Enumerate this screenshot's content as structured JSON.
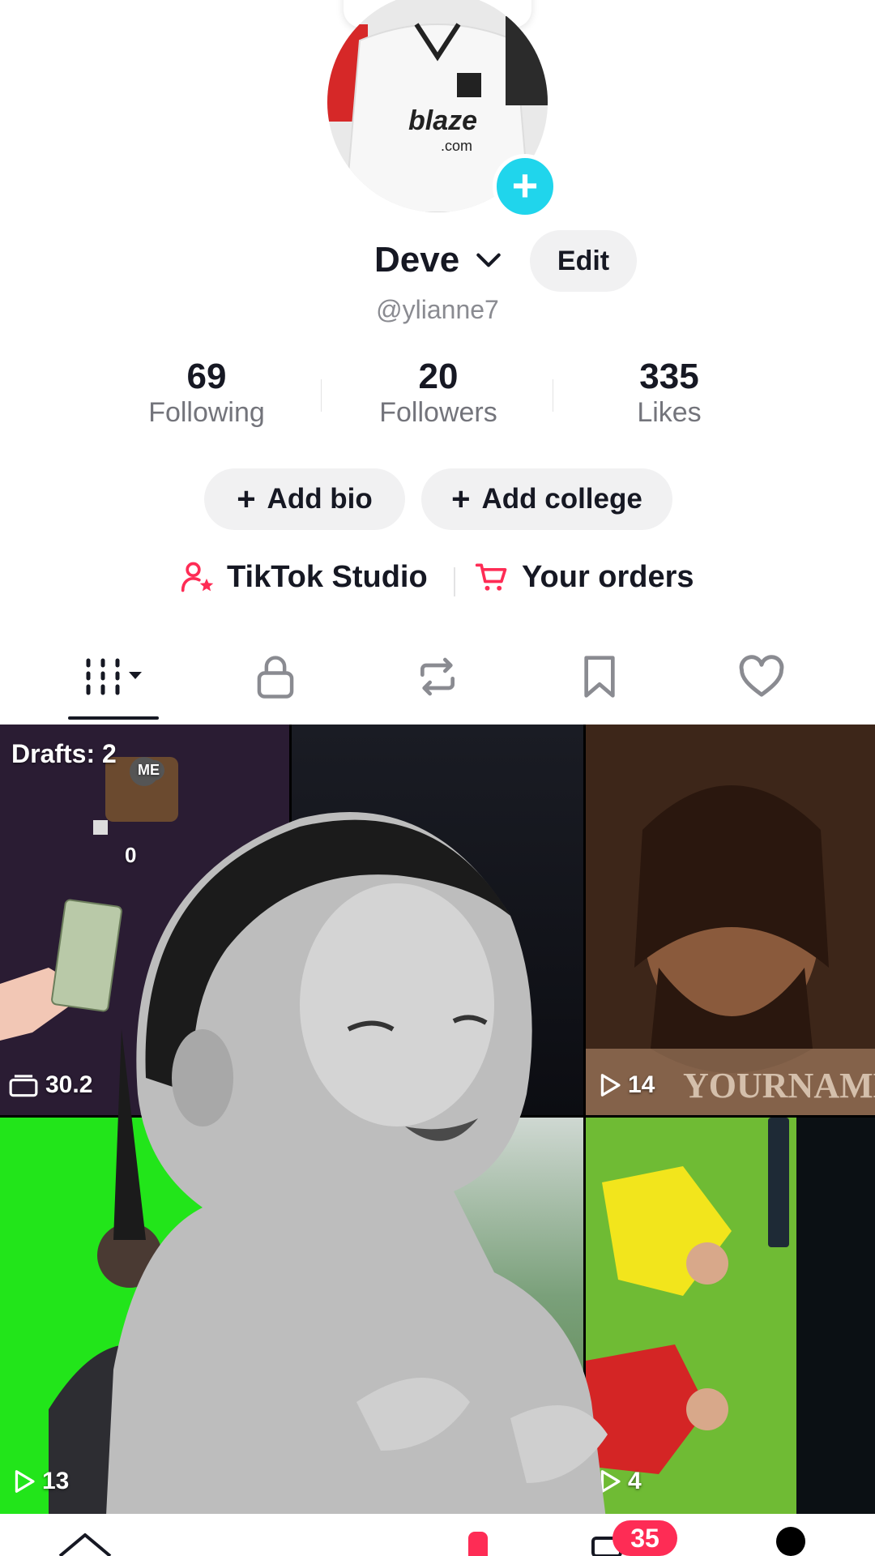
{
  "profile": {
    "display_name": "Deve",
    "username": "@ylianne7",
    "edit_label": "Edit"
  },
  "stats": [
    {
      "value": "69",
      "label": "Following"
    },
    {
      "value": "20",
      "label": "Followers"
    },
    {
      "value": "335",
      "label": "Likes"
    }
  ],
  "actions": {
    "add_bio": "Add bio",
    "add_college": "Add college",
    "plus": "+"
  },
  "links": {
    "studio": "TikTok Studio",
    "orders": "Your orders"
  },
  "tabs": [
    {
      "name": "videos",
      "icon": "grid-icon"
    },
    {
      "name": "private",
      "icon": "lock-icon"
    },
    {
      "name": "reposts",
      "icon": "repost-icon"
    },
    {
      "name": "favorites",
      "icon": "bookmark-icon"
    },
    {
      "name": "liked",
      "icon": "heart-icon"
    }
  ],
  "grid": {
    "drafts_label": "Drafts: 2",
    "tile1_number": "0",
    "tile1_views": "30.2",
    "tile3_views": "14",
    "tile3_watermark": "YOURNAME",
    "tile4_views": "13",
    "tile6_views": "4",
    "tile1_badge": "ME"
  },
  "bottom_nav": {
    "inbox_badge": "35"
  },
  "colors": {
    "accent_cyan": "#20d5ec",
    "accent_red": "#fe2c55",
    "green_screen": "#22e51a"
  }
}
